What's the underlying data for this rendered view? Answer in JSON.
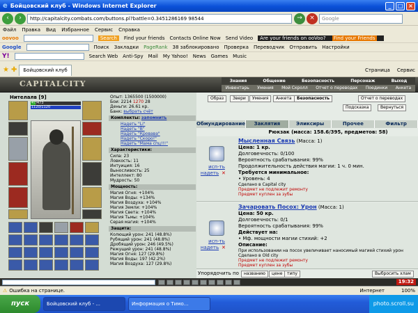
{
  "window": {
    "title": "Бойцовский клуб - Windows Internet Explorer"
  },
  "address": {
    "url": "http://capitalcity.combats.com/buttons.pl?battle=0.3451286169 98544",
    "search_placeholder": "Google"
  },
  "menu": [
    "Файл",
    "Правка",
    "Вид",
    "Избранное",
    "Сервис",
    "Справка"
  ],
  "toolbar1": {
    "search_label": "Search",
    "find_friends": "Find your friends",
    "contacts": "Contacts Online Now",
    "send_video": "Send Video",
    "promo": "Are your friends on ooVoo?",
    "promo_link": "Find your Friends"
  },
  "toolbar2": {
    "search_label": "Поиск",
    "bookmarks": "Закладки",
    "pagerank": "PageRank",
    "blocked": "38 заблокировано",
    "check": "Проверка",
    "translator": "Переводчик",
    "send": "Отправить",
    "settings": "Настройки"
  },
  "toolbar3": {
    "search_web": "Search Web",
    "antispy": "Anti-Spy",
    "mail": "Mail",
    "myyahoo": "My Yahoo!",
    "news": "News",
    "games": "Games",
    "music": "Music"
  },
  "tabs": {
    "active": "Бойцовский клуб",
    "page": "Страница",
    "service": "Сервис"
  },
  "game": {
    "logo": "CAPITALCITY",
    "topnav": [
      "Знания",
      "Общение",
      "Безопасность",
      "Персонаж",
      "Выход"
    ],
    "subnav": [
      "Инвентарь",
      "Умения",
      "Мой Скролл",
      "Отчет о переводах",
      "Поединки",
      "Анкета"
    ],
    "character": {
      "name": "Нителалв",
      "level": "[9]",
      "hp": "47/473",
      "mana": "1120/1120",
      "hp_frac": 0.1,
      "mana_frac": 1.0
    },
    "stats_top": {
      "exp": "Опыт: 1365500 (1500000)",
      "battles": "Бои: 2214",
      "fights": "1270",
      "other": "28",
      "money": "Деньги: 26.61 кр.",
      "bank": "Банк:",
      "bank_link": "выбрать счёт"
    },
    "sets_header": "Комплекты:",
    "sets_link": "запомнить",
    "sets": [
      "Надеть \"Li\"",
      "Надеть \"В\"",
      "Надеть \"Кровава\"",
      "Надеть \"Скоро!\"",
      "Надеть \"Мама спц!!!\""
    ],
    "chars_header": "Характеристики:",
    "chars": [
      "Сила: 23",
      "Ловкость: 11",
      "Интуиция: 16",
      "Выносливость: 25",
      "Интеллект: 80",
      "Мудрость: 50"
    ],
    "power_header": "Мощность:",
    "power": [
      "Магия Огня: +104%",
      "Магия Воды: +134%",
      "Магия Воздуха: +104%",
      "Магия Земли: +104%",
      "Магия Света: +104%",
      "Магия Тьмы: +104%",
      "Серая магия: +104%"
    ],
    "prot_header": "Защита:",
    "prot": [
      "Колющий урон: 241 (48.8%)",
      "Рубящий урон: 241 (48.8%)",
      "Дробящий урон: 246 (49.5%)",
      "Режущий урон: 241 (48.8%)",
      "Магия Огня: 127 (29.8%)",
      "Магия Воды: 197 (42.2%)",
      "Магия Воздуха: 127 (29.8%)"
    ],
    "top_buttons": [
      "Образ",
      "Звери",
      "Умения",
      "Анкета",
      "Безопасность",
      "Отчет о переводах"
    ],
    "help_buttons": [
      "Подсказка",
      "Вернуться"
    ],
    "inv_tabs": [
      "Обмундирование",
      "Заклятия",
      "Эликсиры",
      "Прочее",
      "Фильтр"
    ],
    "inv_active": 1,
    "backpack": "Рюкзак (масса: 158.6/395, предметов: 58)",
    "items": [
      {
        "name": "Мысленная Связь",
        "mass": "(Масса: 1)",
        "price": "Цена: 1 кр.",
        "dur": "Долговечность: 0/100",
        "prob": "Вероятность срабатывания: 99%",
        "time": "Продолжительность действия магии: 1 ч. 0 мин.",
        "req": "Требуется минимальное:",
        "req1": "• Уровень: 4",
        "made": "Сделано в Capital city",
        "warn1": "Предмет не подлежит ремонту",
        "warn2": "Предмет куплен за зубы",
        "act_use": "исп-ть",
        "act_wear": "надеть"
      },
      {
        "name": "Зачаровать Посох: Урон",
        "mass": "(Масса: 1)",
        "price": "Цена: 50 кр.",
        "dur": "Долговечность: 0/1",
        "prob": "Вероятность срабатывания: 99%",
        "acts_on": "Действует на:",
        "acts1": "• Мф. мощности магии стихий: +2",
        "desc_h": "Описание:",
        "desc": "При использовании на посох увеличивает наносимый магией стихий урон",
        "made": "Сделано в Old city",
        "warn1": "Предмет не подлежит ремонту",
        "warn2": "Предмет куплен за зубы",
        "act_use": "исп-ть",
        "act_wear": "надеть"
      }
    ],
    "bottom_row": {
      "sort": "Упорядочить по",
      "btn1": "названию",
      "btn2": "цене",
      "btn3": "типу",
      "choose": "Выбросить хлам"
    }
  },
  "clock": "19:32",
  "status": {
    "text": "Ошибка на странице.",
    "zone": "Интернет",
    "zoom": "100%"
  },
  "taskbar": {
    "start": "пуск",
    "task1": "Бойцовский клуб - ...",
    "task2": "Информация о Тимо...",
    "tray": "photo.scroll.su"
  }
}
